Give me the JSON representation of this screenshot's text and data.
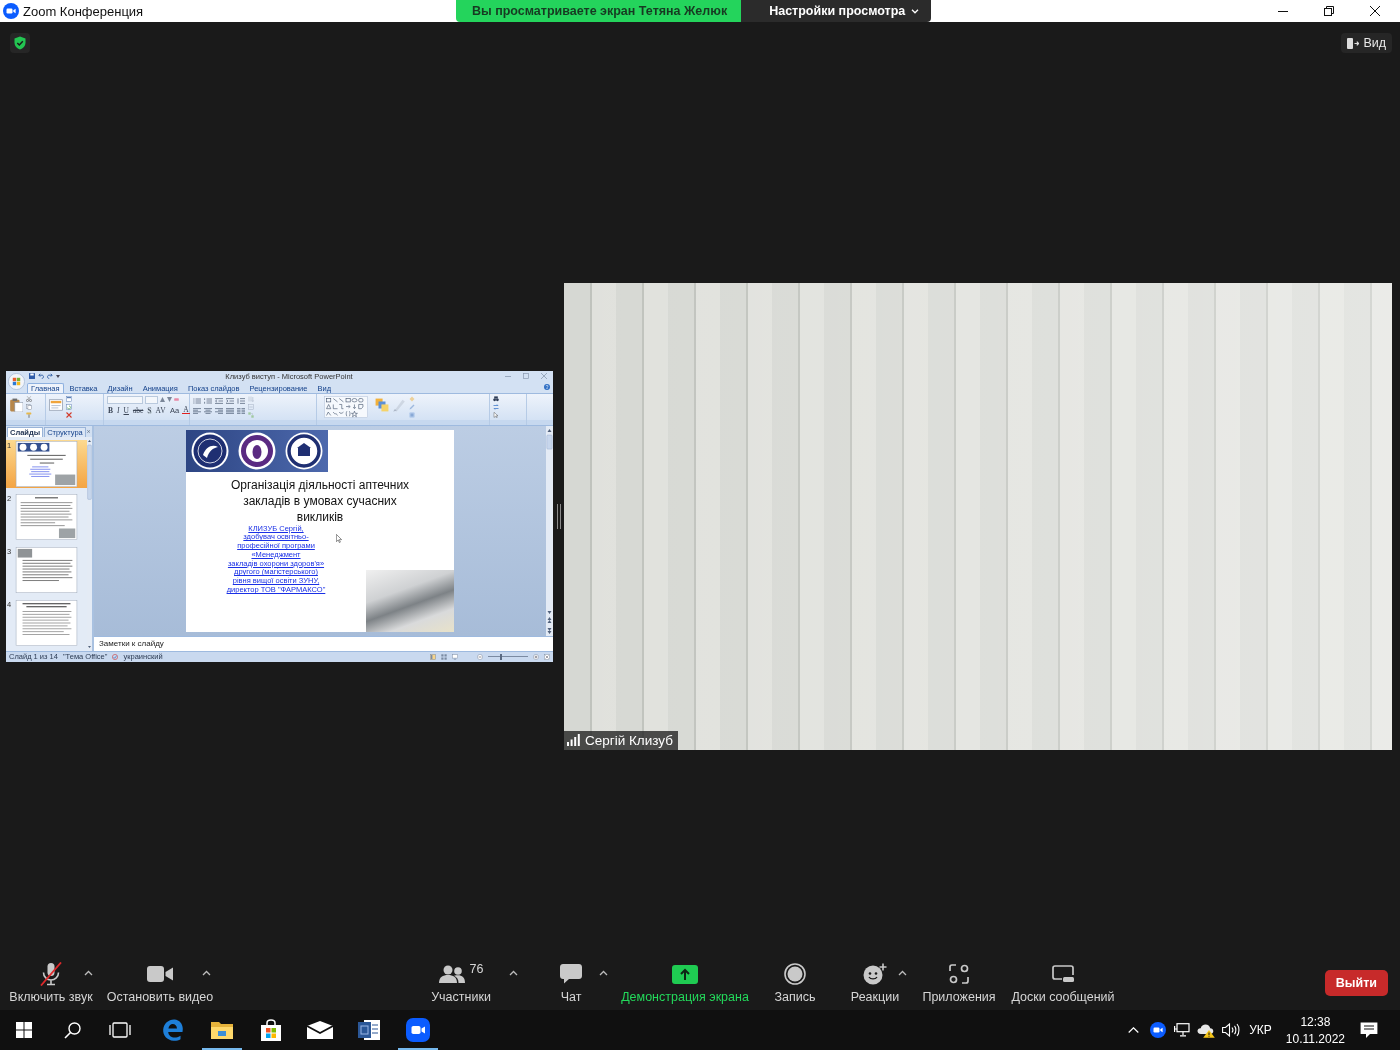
{
  "window": {
    "title": "Zoom Конференция"
  },
  "share_banner": {
    "message": "Вы просматриваете экран Тетяна Желюк",
    "settings": "Настройки просмотра"
  },
  "view_button": {
    "label": "Вид"
  },
  "shared_screen": {
    "title": "Клизуб виступ - Microsoft PowerPoint",
    "tabs": [
      {
        "label": "Главная",
        "selected": true
      },
      {
        "label": "Вставка",
        "selected": false
      },
      {
        "label": "Дизайн",
        "selected": false
      },
      {
        "label": "Анимация",
        "selected": false
      },
      {
        "label": "Показ слайдов",
        "selected": false
      },
      {
        "label": "Рецензирование",
        "selected": false
      },
      {
        "label": "Вид",
        "selected": false
      }
    ],
    "format_buttons": [
      {
        "label": "B",
        "kind": "bold"
      },
      {
        "label": "I",
        "kind": "italic"
      },
      {
        "label": "U",
        "kind": "underline"
      },
      {
        "label": "abe",
        "kind": "strike"
      },
      {
        "label": "S",
        "kind": "shadow"
      },
      {
        "label": "AV",
        "kind": "spacing"
      },
      {
        "label": "Aa",
        "kind": "case"
      },
      {
        "label": "A",
        "kind": "color"
      }
    ],
    "panel_tabs": [
      {
        "label": "Слайды",
        "selected": true
      },
      {
        "label": "Структура",
        "selected": false
      }
    ],
    "thumbnails": [
      {
        "number": "1",
        "kind": "title",
        "selected": true
      },
      {
        "number": "2",
        "kind": "text",
        "selected": false
      },
      {
        "number": "3",
        "kind": "image_text",
        "selected": false
      },
      {
        "number": "4",
        "kind": "bullets",
        "selected": false
      }
    ],
    "slide": {
      "title": "Організація діяльності аптечних закладів в умовах сучасних викликів",
      "subtitle_lines": [
        "КЛИЗУБ Сергій,",
        "здобувач освітньо-",
        "професійної програми",
        "«Менеджмент",
        "закладів охорони здоров'я»",
        "другого (магістерського)",
        "рівня вищої освіти ЗУНУ,",
        "директор ТОВ \"ФАРМАКСО\""
      ]
    },
    "notes": {
      "placeholder": "Заметки к слайду"
    },
    "status_bar": {
      "slide": "Слайд 1 из 14",
      "theme": "\"Тема Office\"",
      "language": "украинский",
      "zoom_slider": {
        "level": 0.33
      }
    }
  },
  "video": {
    "name": "Сергій Клизуб"
  },
  "toolbar": {
    "left": [
      {
        "kind": "mic",
        "label": "Включить звук",
        "muted": true,
        "menu": true
      },
      {
        "kind": "video",
        "label": "Остановить видео",
        "menu": true
      }
    ],
    "center": [
      {
        "kind": "participants",
        "label": "Участники",
        "count": "76",
        "menu": true
      },
      {
        "kind": "chat",
        "label": "Чат",
        "menu": true
      },
      {
        "kind": "share",
        "label": "Демонстрация экрана",
        "menu": false
      },
      {
        "kind": "record",
        "label": "Запись",
        "menu": false
      },
      {
        "kind": "reactions",
        "label": "Реакции",
        "menu": true
      },
      {
        "kind": "apps",
        "label": "Приложения",
        "menu": false
      },
      {
        "kind": "whiteboards",
        "label": "Доски сообщений",
        "menu": false
      }
    ],
    "leave": "Выйти"
  },
  "taskbar": {
    "apps": [
      {
        "kind": "edge",
        "running": false
      },
      {
        "kind": "explorer",
        "running": true
      },
      {
        "kind": "store",
        "running": false
      },
      {
        "kind": "mail",
        "running": false
      },
      {
        "kind": "word",
        "running": false
      },
      {
        "kind": "zoom",
        "running": true
      }
    ],
    "language": "УКР",
    "time": "12:38",
    "date": "10.11.2022"
  }
}
